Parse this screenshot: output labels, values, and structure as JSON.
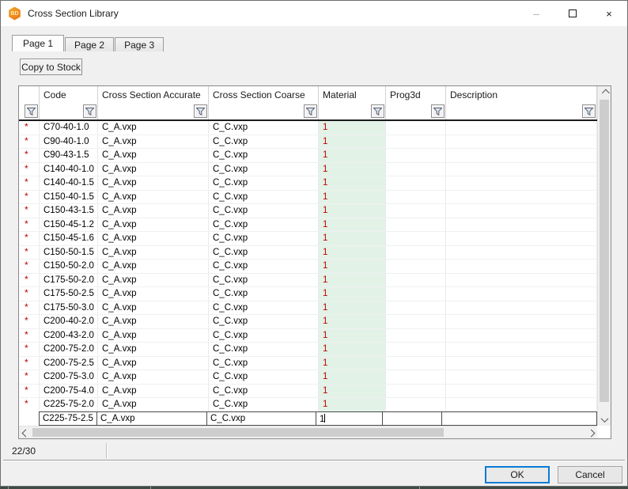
{
  "window": {
    "title": "Cross Section Library",
    "icon_text": "BD"
  },
  "window_controls": {
    "minimize": "–",
    "close": "×"
  },
  "tabs": [
    {
      "label": "Page 1",
      "active": true
    },
    {
      "label": "Page 2",
      "active": false
    },
    {
      "label": "Page 3",
      "active": false
    }
  ],
  "toolbar": {
    "copy_to_stock_label": "Copy to Stock"
  },
  "grid": {
    "columns": [
      "Code",
      "Cross Section Accurate",
      "Cross Section Coarse",
      "Material",
      "Prog3d",
      "Description"
    ],
    "row_marker": "*",
    "rows": [
      {
        "code": "C70-40-1.0",
        "accurate": "C_A.vxp",
        "coarse": "C_C.vxp",
        "material": "1",
        "prog3d": "",
        "description": ""
      },
      {
        "code": "C90-40-1.0",
        "accurate": "C_A.vxp",
        "coarse": "C_C.vxp",
        "material": "1",
        "prog3d": "",
        "description": ""
      },
      {
        "code": "C90-43-1.5",
        "accurate": "C_A.vxp",
        "coarse": "C_C.vxp",
        "material": "1",
        "prog3d": "",
        "description": ""
      },
      {
        "code": "C140-40-1.0",
        "accurate": "C_A.vxp",
        "coarse": "C_C.vxp",
        "material": "1",
        "prog3d": "",
        "description": ""
      },
      {
        "code": "C140-40-1.5",
        "accurate": "C_A.vxp",
        "coarse": "C_C.vxp",
        "material": "1",
        "prog3d": "",
        "description": ""
      },
      {
        "code": "C150-40-1.5",
        "accurate": "C_A.vxp",
        "coarse": "C_C.vxp",
        "material": "1",
        "prog3d": "",
        "description": ""
      },
      {
        "code": "C150-43-1.5",
        "accurate": "C_A.vxp",
        "coarse": "C_C.vxp",
        "material": "1",
        "prog3d": "",
        "description": ""
      },
      {
        "code": "C150-45-1.2",
        "accurate": "C_A.vxp",
        "coarse": "C_C.vxp",
        "material": "1",
        "prog3d": "",
        "description": ""
      },
      {
        "code": "C150-45-1.6",
        "accurate": "C_A.vxp",
        "coarse": "C_C.vxp",
        "material": "1",
        "prog3d": "",
        "description": ""
      },
      {
        "code": "C150-50-1.5",
        "accurate": "C_A.vxp",
        "coarse": "C_C.vxp",
        "material": "1",
        "prog3d": "",
        "description": ""
      },
      {
        "code": "C150-50-2.0",
        "accurate": "C_A.vxp",
        "coarse": "C_C.vxp",
        "material": "1",
        "prog3d": "",
        "description": ""
      },
      {
        "code": "C175-50-2.0",
        "accurate": "C_A.vxp",
        "coarse": "C_C.vxp",
        "material": "1",
        "prog3d": "",
        "description": ""
      },
      {
        "code": "C175-50-2.5",
        "accurate": "C_A.vxp",
        "coarse": "C_C.vxp",
        "material": "1",
        "prog3d": "",
        "description": ""
      },
      {
        "code": "C175-50-3.0",
        "accurate": "C_A.vxp",
        "coarse": "C_C.vxp",
        "material": "1",
        "prog3d": "",
        "description": ""
      },
      {
        "code": "C200-40-2.0",
        "accurate": "C_A.vxp",
        "coarse": "C_C.vxp",
        "material": "1",
        "prog3d": "",
        "description": ""
      },
      {
        "code": "C200-43-2.0",
        "accurate": "C_A.vxp",
        "coarse": "C_C.vxp",
        "material": "1",
        "prog3d": "",
        "description": ""
      },
      {
        "code": "C200-75-2.0",
        "accurate": "C_A.vxp",
        "coarse": "C_C.vxp",
        "material": "1",
        "prog3d": "",
        "description": ""
      },
      {
        "code": "C200-75-2.5",
        "accurate": "C_A.vxp",
        "coarse": "C_C.vxp",
        "material": "1",
        "prog3d": "",
        "description": ""
      },
      {
        "code": "C200-75-3.0",
        "accurate": "C_A.vxp",
        "coarse": "C_C.vxp",
        "material": "1",
        "prog3d": "",
        "description": ""
      },
      {
        "code": "C200-75-4.0",
        "accurate": "C_A.vxp",
        "coarse": "C_C.vxp",
        "material": "1",
        "prog3d": "",
        "description": ""
      },
      {
        "code": "C225-75-2.0",
        "accurate": "C_A.vxp",
        "coarse": "C_C.vxp",
        "material": "1",
        "prog3d": "",
        "description": ""
      }
    ],
    "edit_row": {
      "code": "C225-75-2.5",
      "accurate": "C_A.vxp",
      "coarse": "C_C.vxp",
      "material": "1",
      "prog3d": "",
      "description": ""
    },
    "colors": {
      "material_cell_bg": "#e2f2e7",
      "alert_red": "#c00000",
      "focus_blue": "#0a7bd4"
    }
  },
  "status_bar": {
    "count": "22/30"
  },
  "footer": {
    "ok_label": "OK",
    "cancel_label": "Cancel"
  }
}
